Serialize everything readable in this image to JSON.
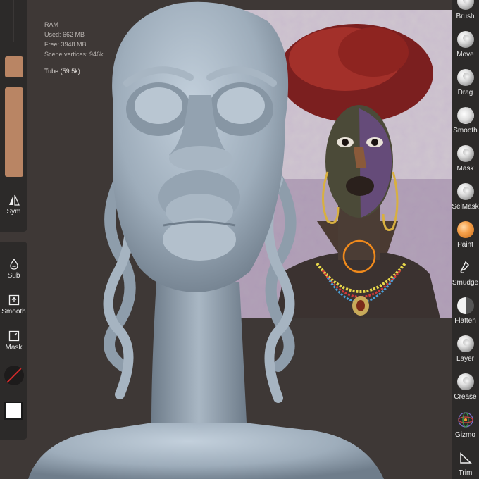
{
  "stats": {
    "ram_label": "RAM",
    "used": "Used: 662 MB",
    "free": "Free: 3948 MB",
    "vertices": "Scene vertices: 946k",
    "object": "Tube (59.5k)"
  },
  "left_tools": {
    "sym": "Sym",
    "sub": "Sub",
    "smooth": "Smooth",
    "mask": "Mask"
  },
  "right_tools": [
    {
      "label": "Brush",
      "icon": "brush-icon"
    },
    {
      "label": "Move",
      "icon": "move-icon"
    },
    {
      "label": "Drag",
      "icon": "drag-icon"
    },
    {
      "label": "Smooth",
      "icon": "smooth-icon"
    },
    {
      "label": "Mask",
      "icon": "mask-icon"
    },
    {
      "label": "SelMask",
      "icon": "selmask-icon"
    },
    {
      "label": "Paint",
      "icon": "paint-icon"
    },
    {
      "label": "Smudge",
      "icon": "smudge-icon"
    },
    {
      "label": "Flatten",
      "icon": "flatten-icon"
    },
    {
      "label": "Layer",
      "icon": "layer-icon"
    },
    {
      "label": "Crease",
      "icon": "crease-icon"
    },
    {
      "label": "Gizmo",
      "icon": "gizmo-icon"
    },
    {
      "label": "Trim",
      "icon": "trim-icon"
    }
  ],
  "colors": {
    "background": "#3e3836",
    "panel": "#2c2a29",
    "swatch": "#b98564",
    "clay": "#9eadbb",
    "paint_accent": "#f5a04a"
  }
}
